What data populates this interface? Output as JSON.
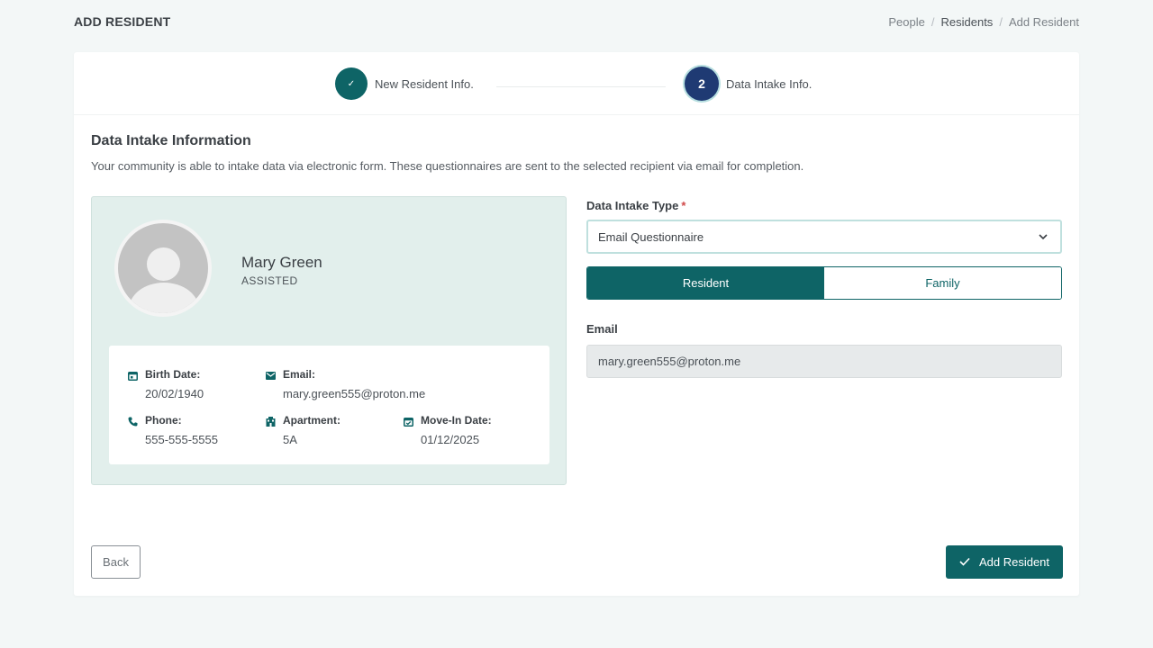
{
  "header": {
    "title": "ADD RESIDENT",
    "breadcrumb": [
      "People",
      "Residents",
      "Add Resident"
    ]
  },
  "stepper": {
    "steps": [
      {
        "label": "New Resident Info.",
        "marker": "✓",
        "state": "completed"
      },
      {
        "label": "Data Intake Info.",
        "marker": "2",
        "state": "active"
      }
    ]
  },
  "section": {
    "title": "Data Intake Information",
    "description": "Your community is able to intake data via electronic form. These questionnaires are sent to the selected recipient via email for completion."
  },
  "resident": {
    "name": "Mary Green",
    "care_level": "ASSISTED",
    "details": {
      "birth_date": {
        "label": "Birth Date:",
        "value": "20/02/1940",
        "icon": "calendar-icon"
      },
      "email": {
        "label": "Email:",
        "value": "mary.green555@proton.me",
        "icon": "mail-icon"
      },
      "phone": {
        "label": "Phone:",
        "value": "555-555-5555",
        "icon": "phone-icon"
      },
      "apartment": {
        "label": "Apartment:",
        "value": "5A",
        "icon": "building-icon"
      },
      "move_in": {
        "label": "Move-In Date:",
        "value": "01/12/2025",
        "icon": "calendar-check-icon"
      }
    }
  },
  "form": {
    "intake_type_label": "Data Intake Type",
    "required_marker": "*",
    "intake_type_value": "Email Questionnaire",
    "recipient_options": [
      "Resident",
      "Family"
    ],
    "recipient_selected": "Resident",
    "email_label": "Email",
    "email_value": "mary.green555@proton.me"
  },
  "actions": {
    "back_label": "Back",
    "submit_label": "Add Resident"
  },
  "colors": {
    "primary": "#0e6466",
    "active_step": "#1f3a73",
    "profile_bg": "#e2efec",
    "page_bg": "#f3f7f7"
  }
}
